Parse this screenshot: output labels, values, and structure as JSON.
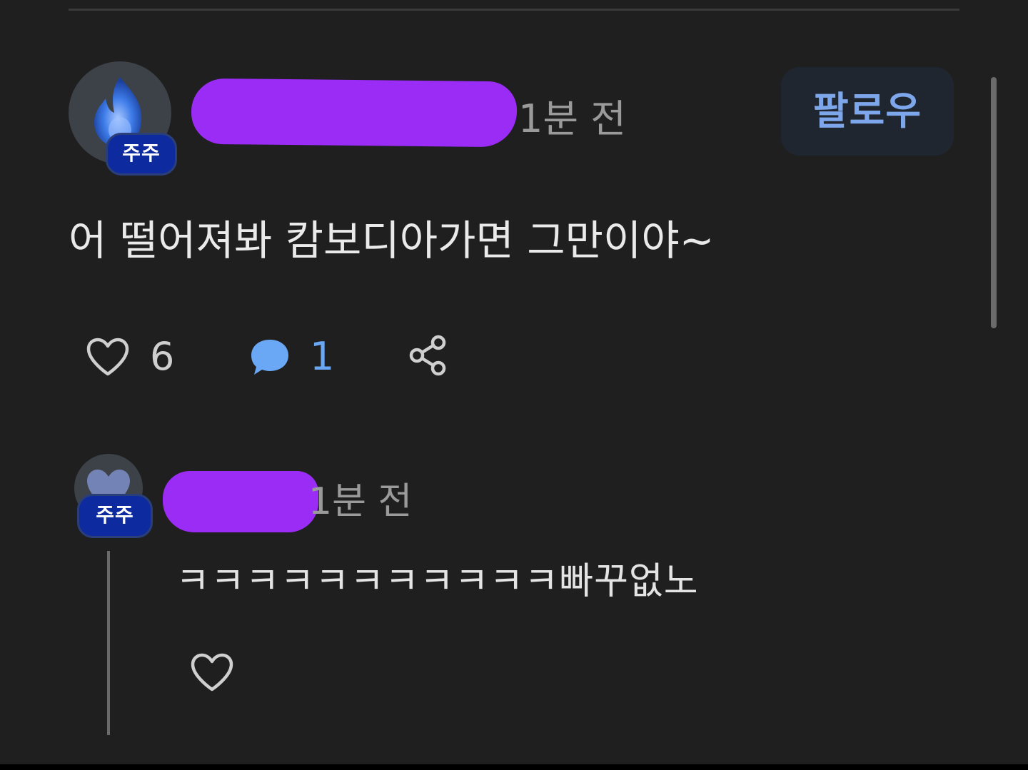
{
  "post": {
    "author_badge": "주주",
    "time": "1분 전",
    "follow_label": "팔로우",
    "text": "어 떨어져봐 캄보디아가면 그만이야~",
    "like_count": "6",
    "reply_count": "1",
    "icons": {
      "like": "heart-outline-icon",
      "reply": "speech-bubble-icon",
      "share": "share-icon"
    }
  },
  "reply": {
    "author_badge": "주주",
    "time": "1분 전",
    "text": "ㅋㅋㅋㅋㅋㅋㅋㅋㅋㅋㅋ빠꾸없노",
    "icons": {
      "like": "heart-outline-icon"
    }
  },
  "colors": {
    "background": "#1f1f1f",
    "redaction": "#9a2cf6",
    "badge": "#0d2a9e",
    "accent_blue": "#6aa8f5",
    "follow_text": "#7ea6ea"
  }
}
